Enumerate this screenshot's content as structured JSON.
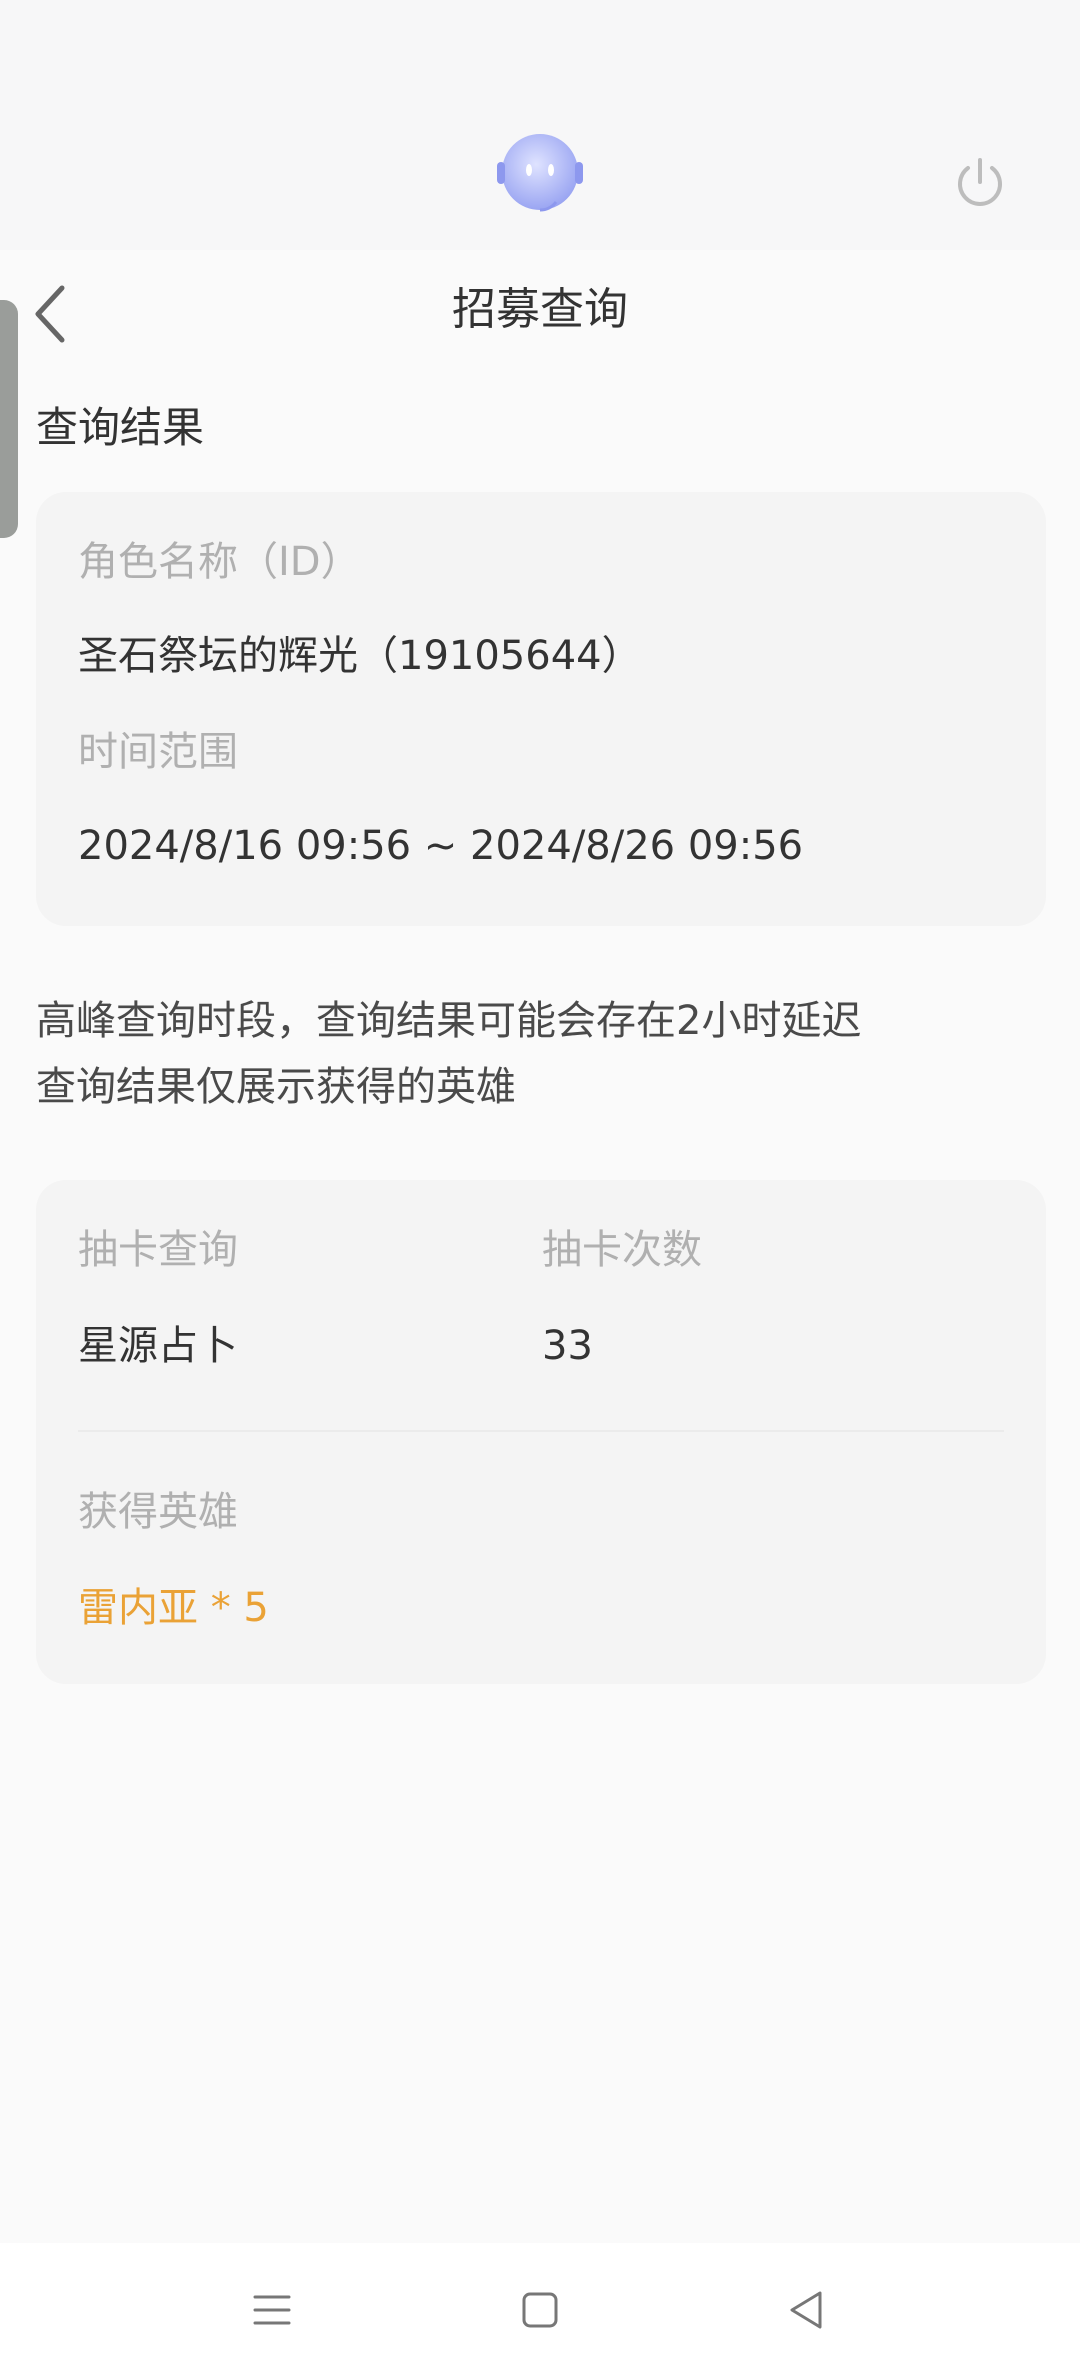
{
  "header": {
    "avatar_icon": "robot-assistant-icon",
    "power_icon": "power-icon"
  },
  "titlebar": {
    "back_icon": "chevron-left-icon",
    "title": "招募查询"
  },
  "section_title": "查询结果",
  "query_card": {
    "role_label": "角色名称（ID）",
    "role_value": "圣石祭坛的辉光（19105644）",
    "time_label": "时间范围",
    "time_value": "2024/8/16 09:56 ~ 2024/8/26 09:56"
  },
  "notice": {
    "line1": "高峰查询时段，查询结果可能会存在2小时延迟",
    "line2": "查询结果仅展示获得的英雄"
  },
  "result_card": {
    "draw_label": "抽卡查询",
    "draw_value": "星源占卜",
    "count_label": "抽卡次数",
    "count_value": "33",
    "hero_label": "获得英雄",
    "hero_value": "雷内亚 * 5"
  },
  "colors": {
    "hero_highlight": "#eaa236",
    "label_gray": "#b0b0b0",
    "card_bg": "#f4f4f4"
  },
  "system_nav": {
    "menu_icon": "menu-icon",
    "home_icon": "square-home-icon",
    "back_icon": "triangle-back-icon"
  }
}
